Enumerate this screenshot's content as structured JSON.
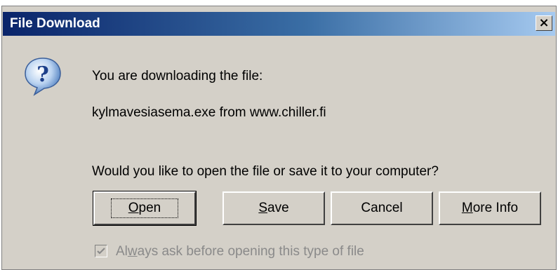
{
  "window": {
    "title": "File Download",
    "close_symbol": "×"
  },
  "icon": {
    "name": "question-icon",
    "glyph": "?"
  },
  "message": {
    "line1": "You are downloading the file:",
    "line2": "kylmavesiasema.exe from www.chiller.fi",
    "question": "Would you like to open the file or save it to your computer?"
  },
  "buttons": {
    "open": {
      "mnemonic": "O",
      "rest": "pen"
    },
    "save": {
      "mnemonic": "S",
      "rest": "ave"
    },
    "cancel": {
      "label": "Cancel"
    },
    "more_info": {
      "mnemonic": "M",
      "rest": "ore Info"
    }
  },
  "checkbox": {
    "checked": true,
    "label_pre": "Al",
    "mnemonic": "w",
    "label_post": "ays ask before opening this type of file"
  },
  "colors": {
    "dialog_bg": "#d4d0c8",
    "title_start": "#0a246a",
    "title_end": "#a6caf0",
    "disabled_text": "#8a8a8a"
  }
}
